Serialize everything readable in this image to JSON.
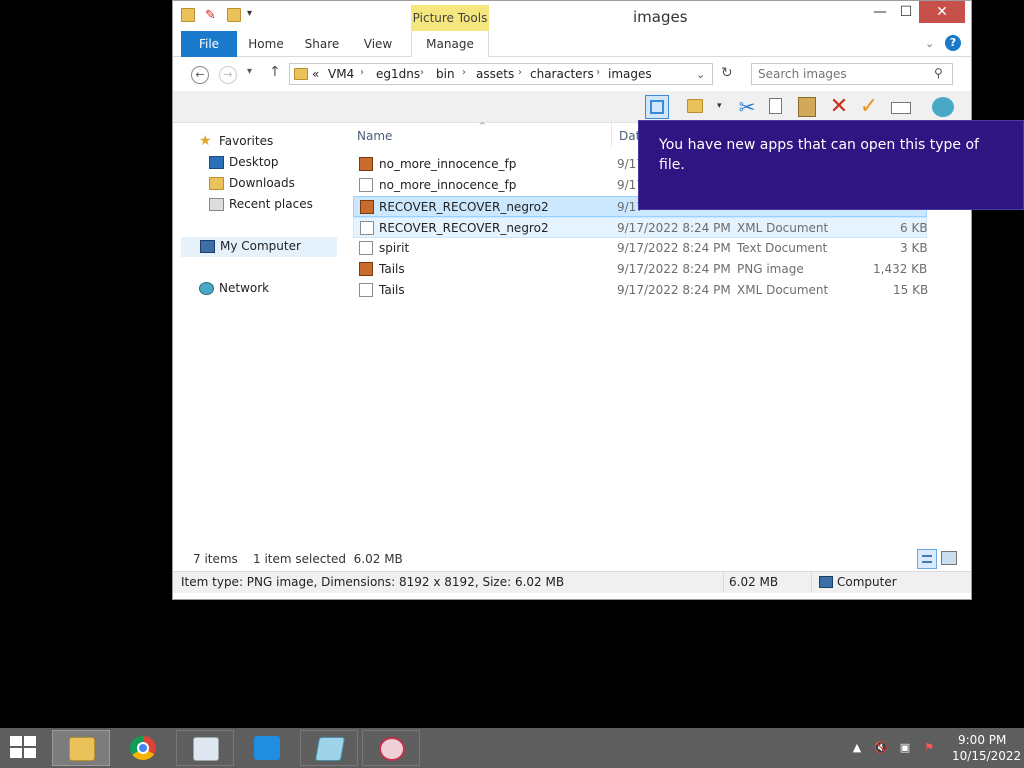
{
  "window": {
    "title": "images",
    "picture_tools": "Picture Tools",
    "minimize": "—",
    "maximize": "☐",
    "close": "✕"
  },
  "ribbon": {
    "tabs": [
      "File",
      "Home",
      "Share",
      "View",
      "Manage"
    ]
  },
  "address": {
    "overflow": "«",
    "crumbs": [
      "VM4",
      "eg1dns",
      "bin",
      "assets",
      "characters",
      "images"
    ],
    "search_placeholder": "Search images"
  },
  "nav": {
    "favorites": "Favorites",
    "desktop": "Desktop",
    "downloads": "Downloads",
    "recent": "Recent places",
    "computer": "My Computer",
    "network": "Network"
  },
  "columns": {
    "name": "Name",
    "date": "Date"
  },
  "files": [
    {
      "name": "no_more_innocence_fp",
      "date": "9/17",
      "type": "",
      "size": "",
      "icon": "image"
    },
    {
      "name": "no_more_innocence_fp",
      "date": "9/17",
      "type": "",
      "size": "",
      "icon": "xml"
    },
    {
      "name": "RECOVER_RECOVER_negro2",
      "date": "9/17",
      "type": "",
      "size": "",
      "icon": "image"
    },
    {
      "name": "RECOVER_RECOVER_negro2",
      "date": "9/17/2022 8:24 PM",
      "type": "XML Document",
      "size": "6 KB",
      "icon": "xml"
    },
    {
      "name": "spirit",
      "date": "9/17/2022 8:24 PM",
      "type": "Text Document",
      "size": "3 KB",
      "icon": "text"
    },
    {
      "name": "Tails",
      "date": "9/17/2022 8:24 PM",
      "type": "PNG image",
      "size": "1,432 KB",
      "icon": "image"
    },
    {
      "name": "Tails",
      "date": "9/17/2022 8:24 PM",
      "type": "XML Document",
      "size": "15 KB",
      "icon": "xml"
    }
  ],
  "toast": {
    "message": "You have new apps that can open this type of file."
  },
  "status": {
    "count": "7 items",
    "selected": "1 item selected  6.02 MB",
    "details": "Item type: PNG image, Dimensions: 8192 x 8192, Size: 6.02 MB",
    "size": "6.02 MB",
    "location": "Computer"
  },
  "clock": {
    "time": "9:00 PM",
    "date": "10/15/2022"
  },
  "colors": {
    "accent": "#1979ca",
    "toast": "#2e1581",
    "selection": "#cce8ff",
    "taskbar": "#5e5e5e"
  }
}
